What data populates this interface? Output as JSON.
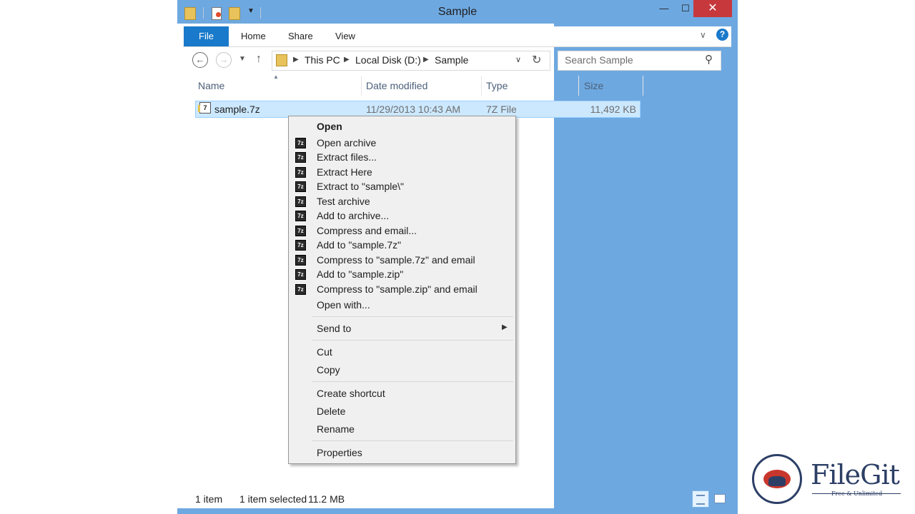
{
  "window": {
    "title": "Sample",
    "controls": {
      "minimize": "—",
      "maximize": "☐",
      "close": "✕"
    }
  },
  "ribbon": {
    "tabs": [
      "File",
      "Home",
      "Share",
      "View"
    ],
    "help": "?"
  },
  "nav": {
    "breadcrumb": [
      "This PC",
      "Local Disk (D:)",
      "Sample"
    ],
    "search_placeholder": "Search Sample"
  },
  "columns": [
    "Name",
    "Date modified",
    "Type",
    "Size"
  ],
  "files": [
    {
      "name": "sample.7z",
      "date": "11/29/2013 10:43 AM",
      "type": "7Z File",
      "size": "11,492 KB",
      "icon_text": "7"
    }
  ],
  "context_menu": {
    "open": "Open",
    "seven_zip_icon": "7z",
    "seven_zip_items": [
      "Open archive",
      "Extract files...",
      "Extract Here",
      "Extract to \"sample\\\"",
      "Test archive",
      "Add to archive...",
      "Compress and email...",
      "Add to \"sample.7z\"",
      "Compress to \"sample.7z\" and email",
      "Add to \"sample.zip\"",
      "Compress to \"sample.zip\" and email"
    ],
    "open_with": "Open with...",
    "send_to": "Send to",
    "cut": "Cut",
    "copy": "Copy",
    "create_shortcut": "Create shortcut",
    "delete": "Delete",
    "rename": "Rename",
    "properties": "Properties"
  },
  "status": {
    "count": "1 item",
    "selection": "1 item selected",
    "size": "11.2 MB"
  },
  "watermark": {
    "brand": "FileGit",
    "tagline": "Free & Unlimited"
  },
  "colors": {
    "accent": "#1979ca",
    "selection": "#cce8ff",
    "close_button": "#c7383c"
  }
}
